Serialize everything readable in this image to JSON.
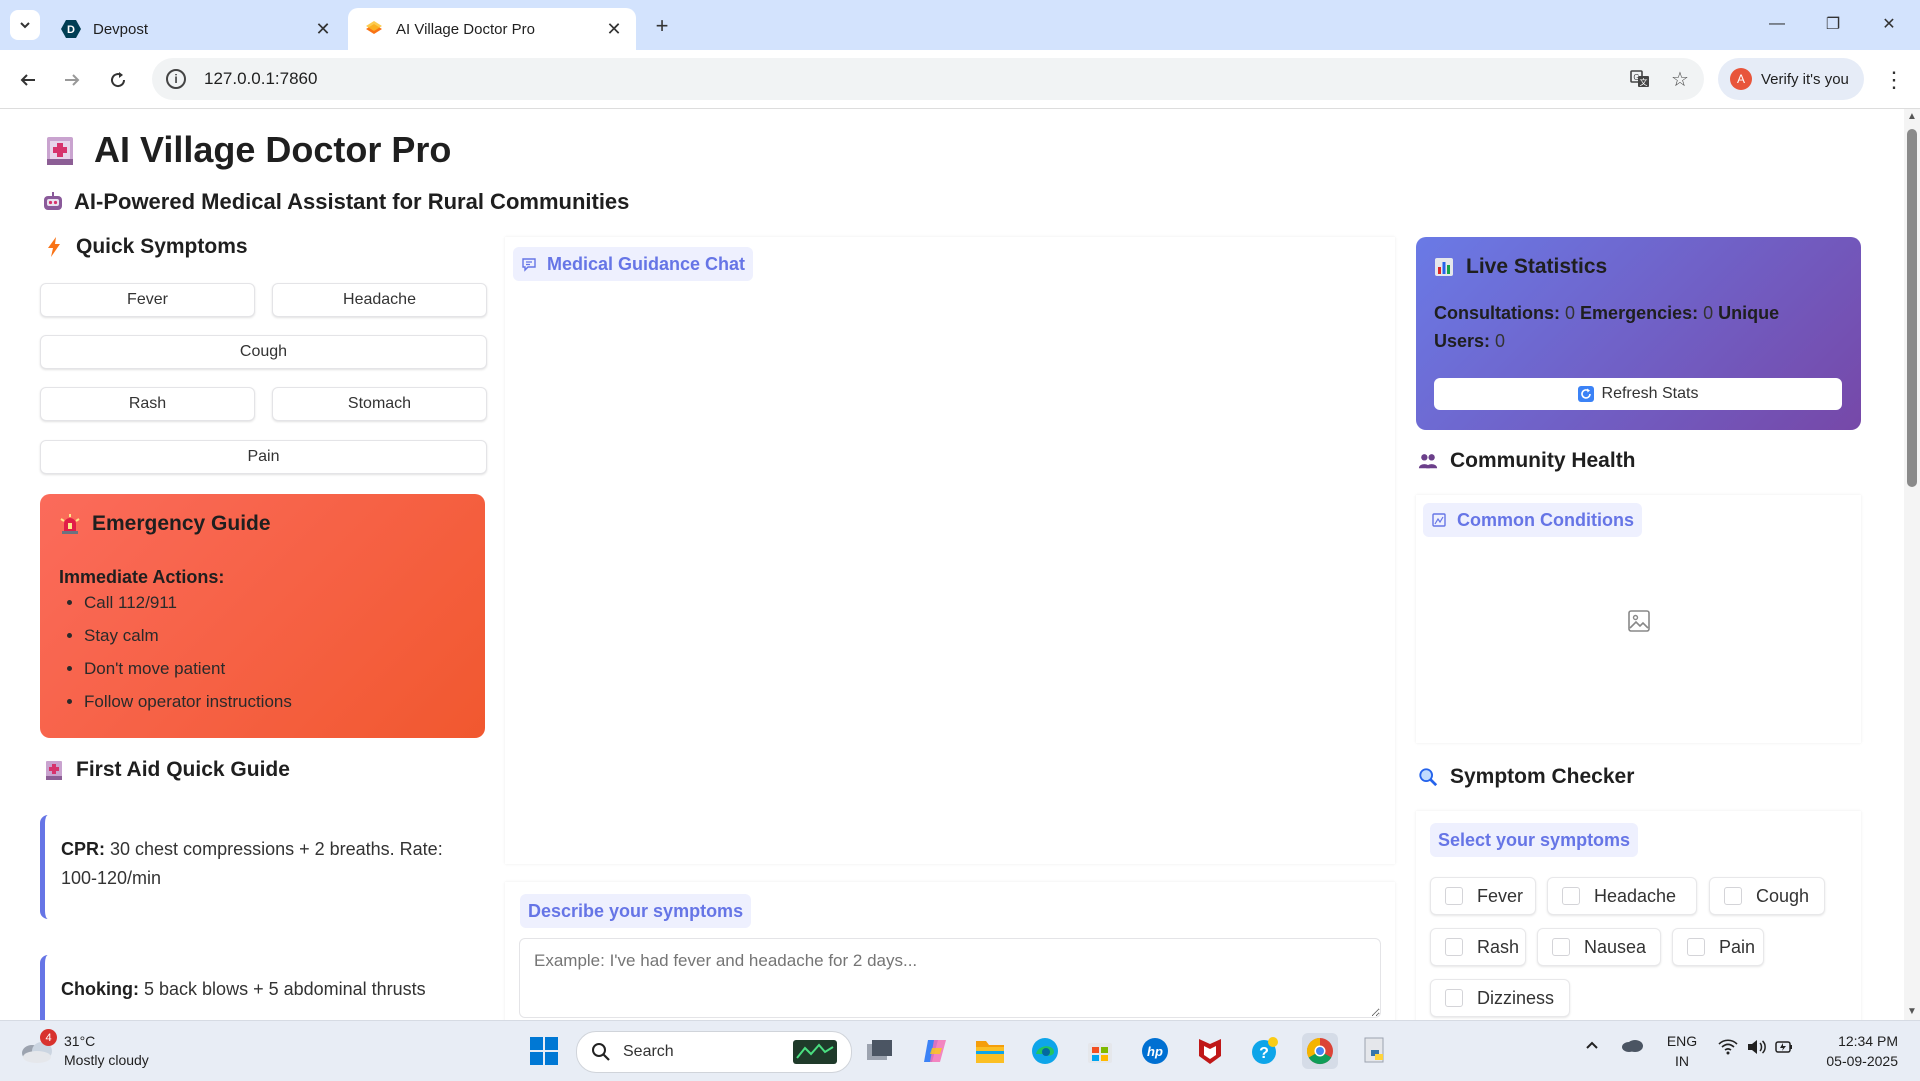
{
  "browser": {
    "tabs": [
      {
        "title": "Devpost",
        "active": false
      },
      {
        "title": "AI Village Doctor Pro",
        "active": true
      }
    ],
    "url": "127.0.0.1:7860",
    "profile_label": "Verify it's you",
    "profile_initial": "A"
  },
  "page": {
    "title": "AI Village Doctor Pro",
    "subtitle": "AI-Powered Medical Assistant for Rural Communities",
    "quick_symptoms": {
      "heading": "Quick Symptoms",
      "buttons": [
        "Fever",
        "Headache",
        "Cough",
        "Rash",
        "Stomach",
        "Pain"
      ]
    },
    "emergency": {
      "heading": "Emergency Guide",
      "subheading": "Immediate Actions:",
      "items": [
        "Call 112/911",
        "Stay calm",
        "Don't move patient",
        "Follow operator instructions"
      ]
    },
    "first_aid": {
      "heading": "First Aid Quick Guide",
      "cards": [
        {
          "label": "CPR:",
          "text": "30 chest compressions + 2 breaths. Rate: 100-120/min"
        },
        {
          "label": "Choking:",
          "text": "5 back blows + 5 abdominal thrusts"
        }
      ]
    },
    "chat": {
      "label": "Medical Guidance Chat"
    },
    "describe": {
      "label": "Describe your symptoms",
      "placeholder": "Example: I've had fever and headache for 2 days..."
    },
    "stats": {
      "heading": "Live Statistics",
      "consultations_label": "Consultations:",
      "consultations_value": "0",
      "emergencies_label": "Emergencies:",
      "emergencies_value": "0",
      "unique_label": "Unique Users:",
      "unique_value": "0",
      "refresh_label": "Refresh Stats"
    },
    "community": {
      "heading": "Community Health",
      "plot_label": "Common Conditions"
    },
    "checker": {
      "heading": "Symptom Checker",
      "label": "Select your symptoms",
      "options": [
        "Fever",
        "Headache",
        "Cough",
        "Rash",
        "Nausea",
        "Pain",
        "Dizziness"
      ]
    }
  },
  "taskbar": {
    "weather_badge": "4",
    "temperature": "31°C",
    "condition": "Mostly cloudy",
    "search_label": "Search",
    "lang_line1": "ENG",
    "lang_line2": "IN",
    "time": "12:34 PM",
    "date": "05-09-2025"
  },
  "colors": {
    "accent": "#6675e6",
    "emergency_gradient": [
      "#fb6b5b",
      "#f1582f"
    ],
    "stats_gradient": [
      "#6a7ae6",
      "#7648a8"
    ],
    "tabbar": "#d3e3fd"
  }
}
